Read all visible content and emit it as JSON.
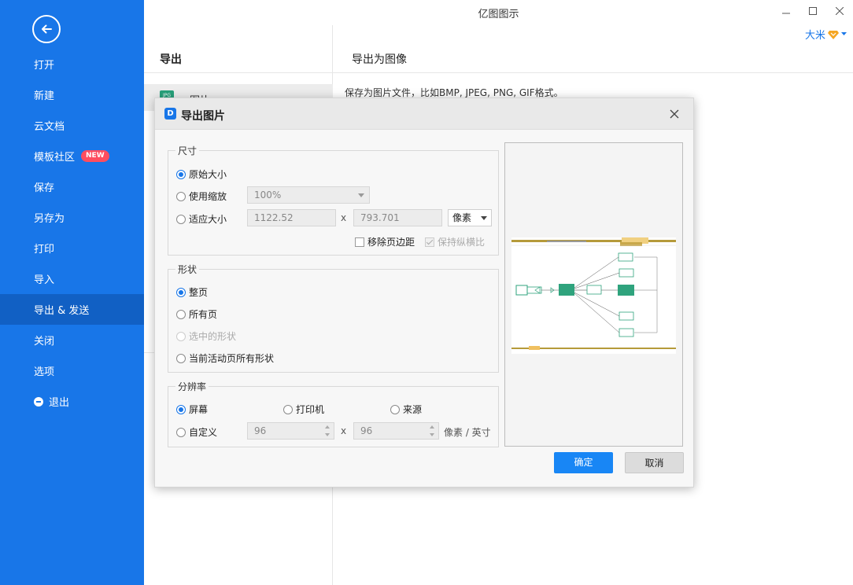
{
  "app": {
    "title": "亿图图示"
  },
  "user": {
    "name": "大米"
  },
  "sidebar": {
    "items": [
      {
        "label": "打开"
      },
      {
        "label": "新建"
      },
      {
        "label": "云文档"
      },
      {
        "label": "模板社区",
        "badge": "NEW"
      },
      {
        "label": "保存"
      },
      {
        "label": "另存为"
      },
      {
        "label": "打印"
      },
      {
        "label": "导入"
      },
      {
        "label": "导出 & 发送",
        "active": true
      },
      {
        "label": "关闭"
      },
      {
        "label": "选项"
      },
      {
        "label": "退出"
      }
    ]
  },
  "left_panel": {
    "title": "导出",
    "selected_item": "图片",
    "icon_text": "JPG"
  },
  "right_panel": {
    "title": "导出为图像",
    "description": "保存为图片文件，比如BMP, JPEG, PNG, GIF格式。"
  },
  "dialog": {
    "title": "导出图片",
    "size_group": {
      "legend": "尺寸",
      "options": [
        "原始大小",
        "使用缩放",
        "适应大小"
      ],
      "selected": "原始大小",
      "zoom_value": "100%",
      "width_value": "1122.52",
      "height_value": "793.701",
      "x_sep": "x",
      "unit": "像素",
      "remove_margin_label": "移除页边距",
      "keep_ratio_label": "保持纵横比"
    },
    "shape_group": {
      "legend": "形状",
      "options": [
        "整页",
        "所有页",
        "选中的形状",
        "当前活动页所有形状"
      ],
      "selected": "整页"
    },
    "resolution_group": {
      "legend": "分辨率",
      "options": [
        "屏幕",
        "打印机",
        "来源",
        "自定义"
      ],
      "selected": "屏幕",
      "custom_x": "96",
      "custom_y": "96",
      "x_sep": "x",
      "unit_label": "像素 / 英寸"
    },
    "ok_label": "确定",
    "cancel_label": "取消"
  },
  "colors": {
    "sidebar_bg": "#1876e8",
    "sidebar_active": "#1160c4",
    "primary_button": "#1886f5",
    "badge_new": "#ff4d5f"
  }
}
